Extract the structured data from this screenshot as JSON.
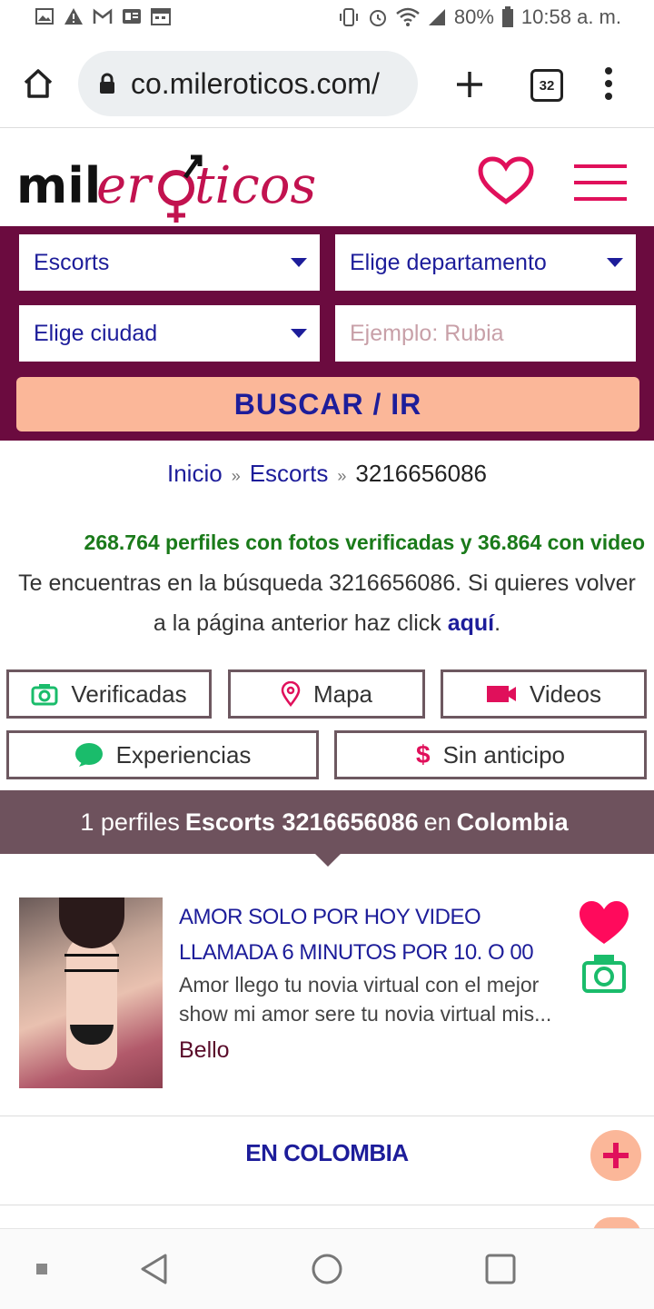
{
  "status_bar": {
    "battery": "80%",
    "time": "10:58 a. m.",
    "notification_icons": [
      "image-icon",
      "warning-icon",
      "gmail-icon",
      "news-icon",
      "calendar-icon"
    ],
    "system_icons": [
      "vibrate-icon",
      "alarm-icon",
      "wifi-icon",
      "signal-icon",
      "battery-icon"
    ]
  },
  "browser": {
    "url": "co.mileroticos.com/",
    "tab_count": "32"
  },
  "site": {
    "logo_text": "mileroticos",
    "brand_color": "#e0105b",
    "panel_color": "#6b0b3f"
  },
  "search": {
    "category": "Escorts",
    "department": "Elige departamento",
    "city": "Elige ciudad",
    "keyword_placeholder": "Ejemplo: Rubia",
    "button_label": "BUSCAR / IR"
  },
  "breadcrumb": {
    "home": "Inicio",
    "section": "Escorts",
    "current": "3216656086",
    "separator": "»"
  },
  "stats_text": "268.764 perfiles con fotos verificadas y 36.864 con video",
  "search_info": {
    "text": "Te encuentras en la búsqueda 3216656086. Si quieres volver a la página anterior haz click ",
    "link": "aquí",
    "end": "."
  },
  "filters": {
    "verified": "Verificadas",
    "map": "Mapa",
    "videos": "Videos",
    "experiences": "Experiencias",
    "no_deposit": "Sin anticipo"
  },
  "results_header": {
    "prefix": "1 perfiles",
    "query": "Escorts 3216656086",
    "middle": "en",
    "country": "Colombia"
  },
  "listing": {
    "title": "AMOR SOLO POR HOY VIDEO LLAMADA 6 MINUTOS POR 10. O 00",
    "description": "Amor llego tu novia virtual con el mejor show mi amor sere tu novia virtual mis...",
    "location": "Bello"
  },
  "section_more": "EN COLOMBIA"
}
